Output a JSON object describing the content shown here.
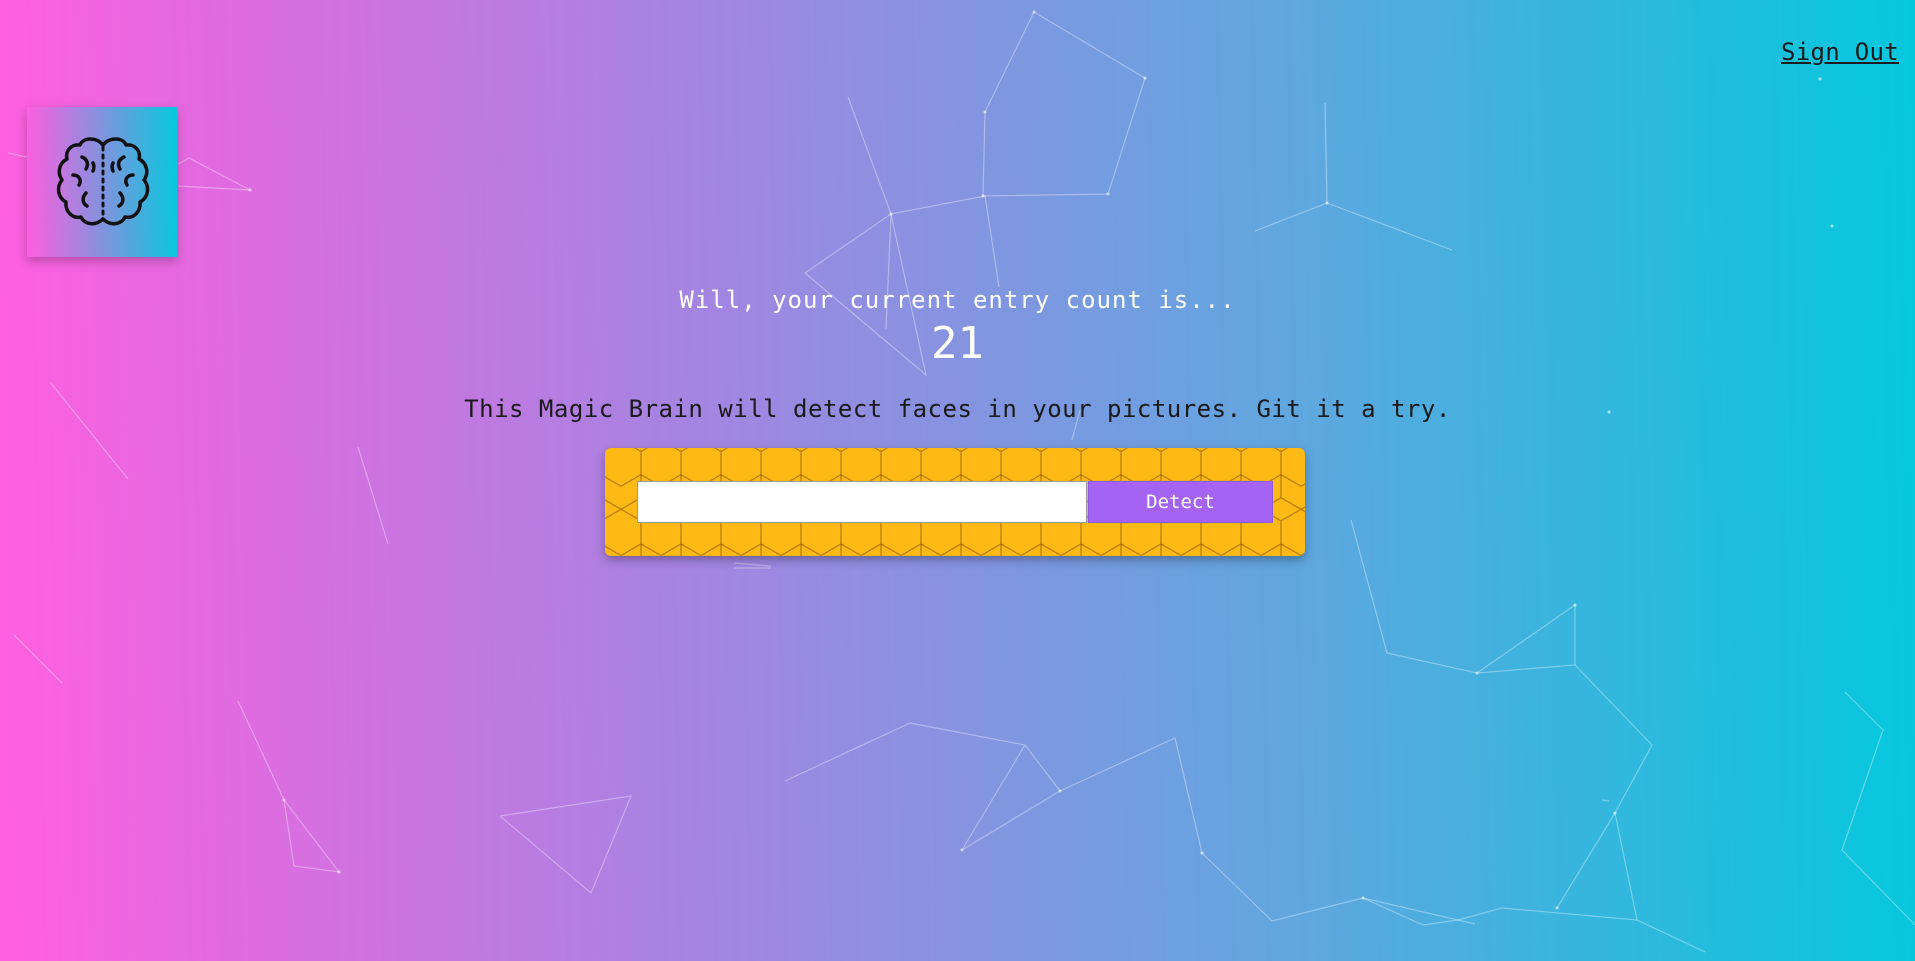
{
  "nav": {
    "sign_out_label": "Sign Out"
  },
  "logo": {
    "icon": "brain-icon"
  },
  "rank": {
    "message": "Will, your current entry count is...",
    "count": "21"
  },
  "tagline": "This Magic Brain will detect faces in your pictures. Git it a try.",
  "form": {
    "input_value": "",
    "input_placeholder": "",
    "button_label": "Detect"
  },
  "colors": {
    "gradient_start": "#ff5edf",
    "gradient_end": "#04c8de",
    "panel": "#ffb914",
    "button": "#a463f2"
  }
}
